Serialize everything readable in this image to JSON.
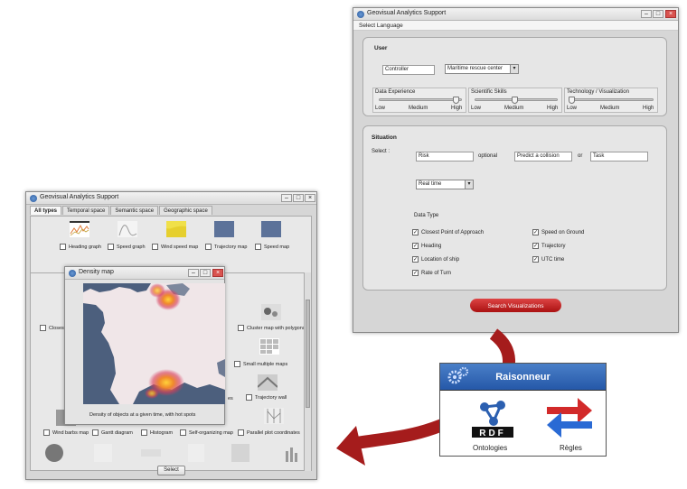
{
  "colors": {
    "search_button": "#b41c1c",
    "reasoner_header": "#2f65b5",
    "arrow_red": "#b01c1c",
    "arrow_blue": "#2a6ad4"
  },
  "main_window": {
    "title": "Geovisual Analytics Support",
    "menu": "Select Language",
    "user": {
      "heading": "User",
      "role_value": "Controller",
      "organization_value": "Maritime rescue center",
      "skills": [
        {
          "label": "Data Experience",
          "low": "Low",
          "medium": "Medium",
          "high": "High",
          "level": 0.95
        },
        {
          "label": "Scientific Skills",
          "low": "Low",
          "medium": "Medium",
          "high": "High",
          "level": 0.5
        },
        {
          "label": "Technology / Visualization",
          "low": "Low",
          "medium": "Medium",
          "high": "High",
          "level": 0.05
        }
      ]
    },
    "situation": {
      "heading": "Situation",
      "select_label": "Select :",
      "risk_value": "Risk",
      "optional_label": "optional",
      "predict_value": "Predict a collision",
      "or_label": "or",
      "task_value": "Task",
      "time_value": "Real time",
      "data_type_label": "Data Type",
      "data_types": [
        {
          "label": "Closest Point of Approach",
          "checked": true
        },
        {
          "label": "Speed on Ground",
          "checked": true
        },
        {
          "label": "Heading",
          "checked": true
        },
        {
          "label": "Trajectory",
          "checked": true
        },
        {
          "label": "Location of ship",
          "checked": true
        },
        {
          "label": "UTC time",
          "checked": true
        },
        {
          "label": "Rate of Turn",
          "checked": true
        }
      ]
    },
    "search_button": "Search Visualizations"
  },
  "secondary_window": {
    "title": "Geovisual Analytics Support",
    "tabs": [
      "All types",
      "Temporal space",
      "Semantic space",
      "Geographic space"
    ],
    "top_items": [
      "Heading graph",
      "Speed graph",
      "Wind speed map",
      "Trajectory map",
      "Speed map"
    ],
    "left_items": [
      "Closest"
    ],
    "right_items": [
      "Cluster map with polygons",
      "Small multiple maps",
      "Trajectory wall"
    ],
    "partial_label": "es",
    "bottom_items": [
      "Wind barbs map",
      "Gantt diagram",
      "Histogram",
      "Self-organizing map",
      "Parallel plot coordinates"
    ],
    "select_button": "Select"
  },
  "density_window": {
    "title": "Density map",
    "caption": "Density of objects at a given time, with hot spots"
  },
  "reasoner": {
    "title": "Raisonneur",
    "ontologies": "Ontologies",
    "rules": "Règles",
    "rdf": "RDF"
  }
}
